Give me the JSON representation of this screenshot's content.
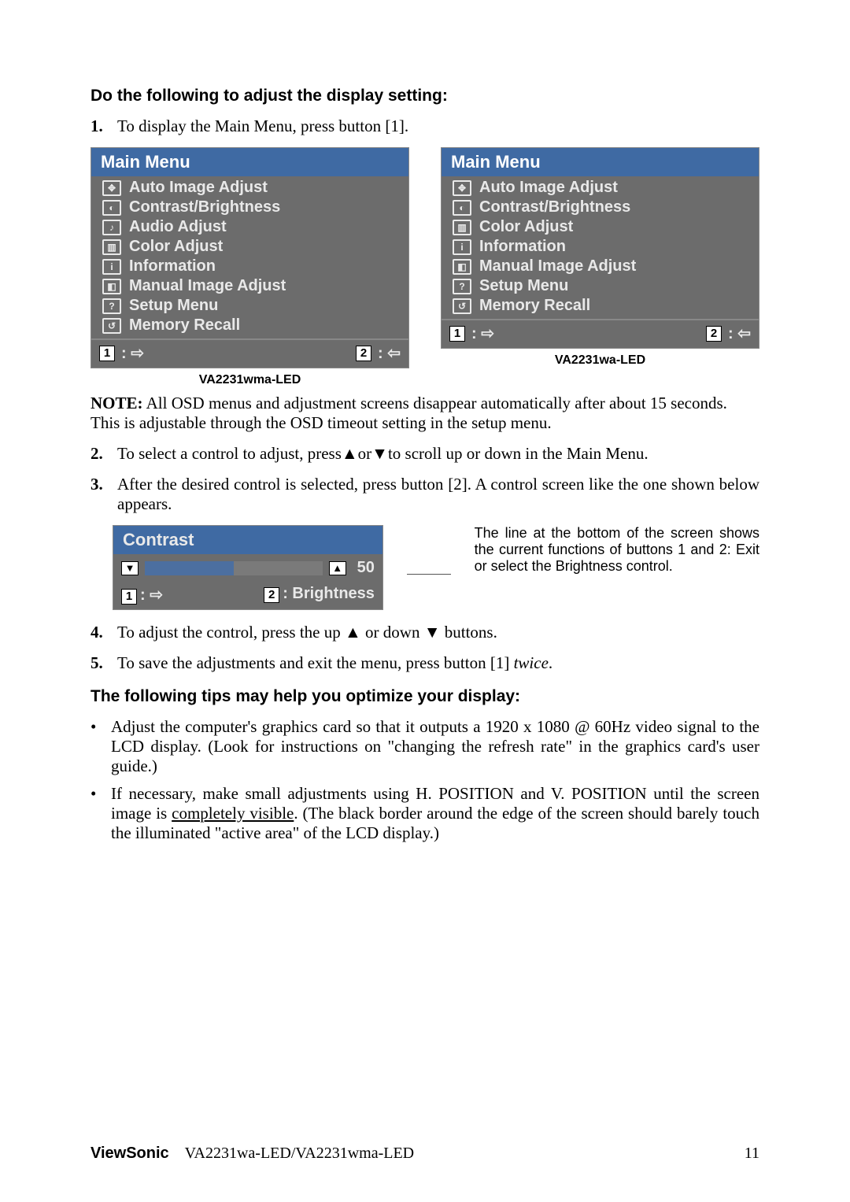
{
  "heading1": "Do the following to adjust the display setting:",
  "step1_num": "1.",
  "step1_text": "To display the Main Menu, press button [1].",
  "osd": {
    "title": "Main Menu",
    "left_items": [
      {
        "icon": "✥",
        "label": "Auto Image Adjust"
      },
      {
        "icon": "◐",
        "label": "Contrast/Brightness"
      },
      {
        "icon": "♪",
        "label": "Audio Adjust"
      },
      {
        "icon": "▥",
        "label": "Color Adjust"
      },
      {
        "icon": "i",
        "label": "Information"
      },
      {
        "icon": "◧",
        "label": "Manual Image Adjust"
      },
      {
        "icon": "?",
        "label": "Setup Menu"
      },
      {
        "icon": "↺",
        "label": "Memory Recall"
      }
    ],
    "right_items": [
      {
        "icon": "✥",
        "label": "Auto Image Adjust"
      },
      {
        "icon": "◐",
        "label": "Contrast/Brightness"
      },
      {
        "icon": "▥",
        "label": "Color Adjust"
      },
      {
        "icon": "i",
        "label": "Information"
      },
      {
        "icon": "◧",
        "label": "Manual Image Adjust"
      },
      {
        "icon": "?",
        "label": "Setup Menu"
      },
      {
        "icon": "↺",
        "label": "Memory Recall"
      }
    ],
    "footer": {
      "k1": "1",
      "g1": ": ⇨",
      "k2": "2",
      "g2": ": ⇦"
    }
  },
  "osd_caption_left": "VA2231wma-LED",
  "osd_caption_right": "VA2231wa-LED",
  "note_label": "NOTE:",
  "note_text": " All OSD menus and adjustment screens disappear automatically after about 15 seconds. This is adjustable through the OSD timeout setting in the setup menu.",
  "step2_num": "2.",
  "step2_text_a": "To select a control to adjust, press",
  "step2_text_b": "or",
  "step2_text_c": "to scroll up or down in the Main Menu.",
  "step3_num": "3.",
  "step3_text": "After the desired control is selected, press button [2]. A control screen like the one shown below appears.",
  "contrast": {
    "title": "Contrast",
    "value": "50",
    "footer_k1": "1",
    "footer_t1": ": ⇨",
    "footer_k2": "2",
    "footer_t2": ": Brightness"
  },
  "callout": "The line at the bottom of the screen shows the current functions of buttons 1 and 2: Exit or select the Brightness control.",
  "step4_num": "4.",
  "step4_a": "To adjust the control, press the up ",
  "step4_b": " or down ",
  "step4_c": " buttons.",
  "step5_num": "5.",
  "step5_a": "To save the adjustments and exit the menu, press button [1] ",
  "step5_twice": "twice",
  "step5_dot": ".",
  "tips_heading": "The following tips may help you optimize your display:",
  "tip1": "Adjust the computer's graphics card so that it outputs a 1920 x 1080 @ 60Hz video signal to the LCD display. (Look for instructions on \"changing the refresh rate\" in the graphics card's user guide.)",
  "tip2_a": "If necessary, make small adjustments using H. POSITION and V. POSITION until the screen image is ",
  "tip2_u": "completely visible",
  "tip2_b": ". (The black border around the edge of the screen should barely touch the illuminated \"active area\" of the LCD display.)",
  "footer_brand": "ViewSonic",
  "footer_model": "VA2231wa-LED/VA2231wma-LED",
  "footer_page": "11",
  "tri_up": "▲",
  "tri_down": "▼"
}
